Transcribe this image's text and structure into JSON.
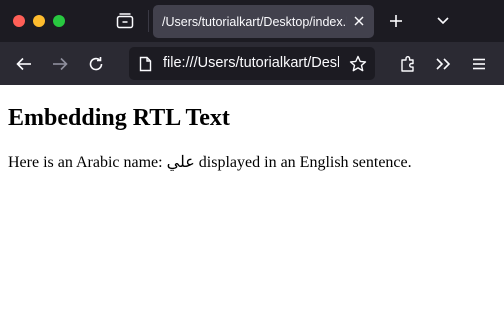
{
  "tab": {
    "title": "/Users/tutorialkart/Desktop/index.html"
  },
  "toolbar": {
    "url": "file:///Users/tutorialkart/Desktop/index.html"
  },
  "page": {
    "heading": "Embedding RTL Text",
    "sentence_before": "Here is an Arabic name: ",
    "arabic_name": "علي",
    "sentence_after": " displayed in an English sentence."
  },
  "colors": {
    "tabbar_bg": "#1c1b22",
    "toolbar_bg": "#2b2a33",
    "active_tab_bg": "#42414d",
    "urlbar_bg": "#1c1b22",
    "close_red": "#ff5f57",
    "minimize_yellow": "#febc2e",
    "zoom_green": "#28c840"
  },
  "icons": [
    "tab-overview-icon",
    "close-tab-icon",
    "plus-icon",
    "chevron-down-icon",
    "back-arrow-icon",
    "forward-arrow-icon",
    "reload-icon",
    "page-icon",
    "star-icon",
    "extensions-icon",
    "double-chevron-icon",
    "hamburger-menu-icon"
  ]
}
